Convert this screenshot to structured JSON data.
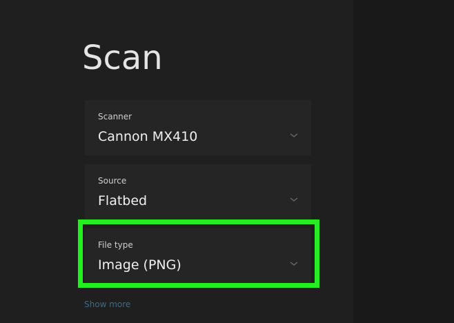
{
  "page": {
    "title": "Scan"
  },
  "fields": [
    {
      "label": "Scanner",
      "value": "Cannon MX410"
    },
    {
      "label": "Source",
      "value": "Flatbed"
    },
    {
      "label": "File type",
      "value": "Image (PNG)"
    }
  ],
  "show_more_label": "Show more",
  "icons": {
    "dropdown": "chevron-down-icon"
  },
  "colors": {
    "background": "#1f1f1f",
    "field_background": "#252525",
    "highlight": "#22ee22",
    "link": "#3f6a86",
    "text": "#f0f0f0"
  }
}
